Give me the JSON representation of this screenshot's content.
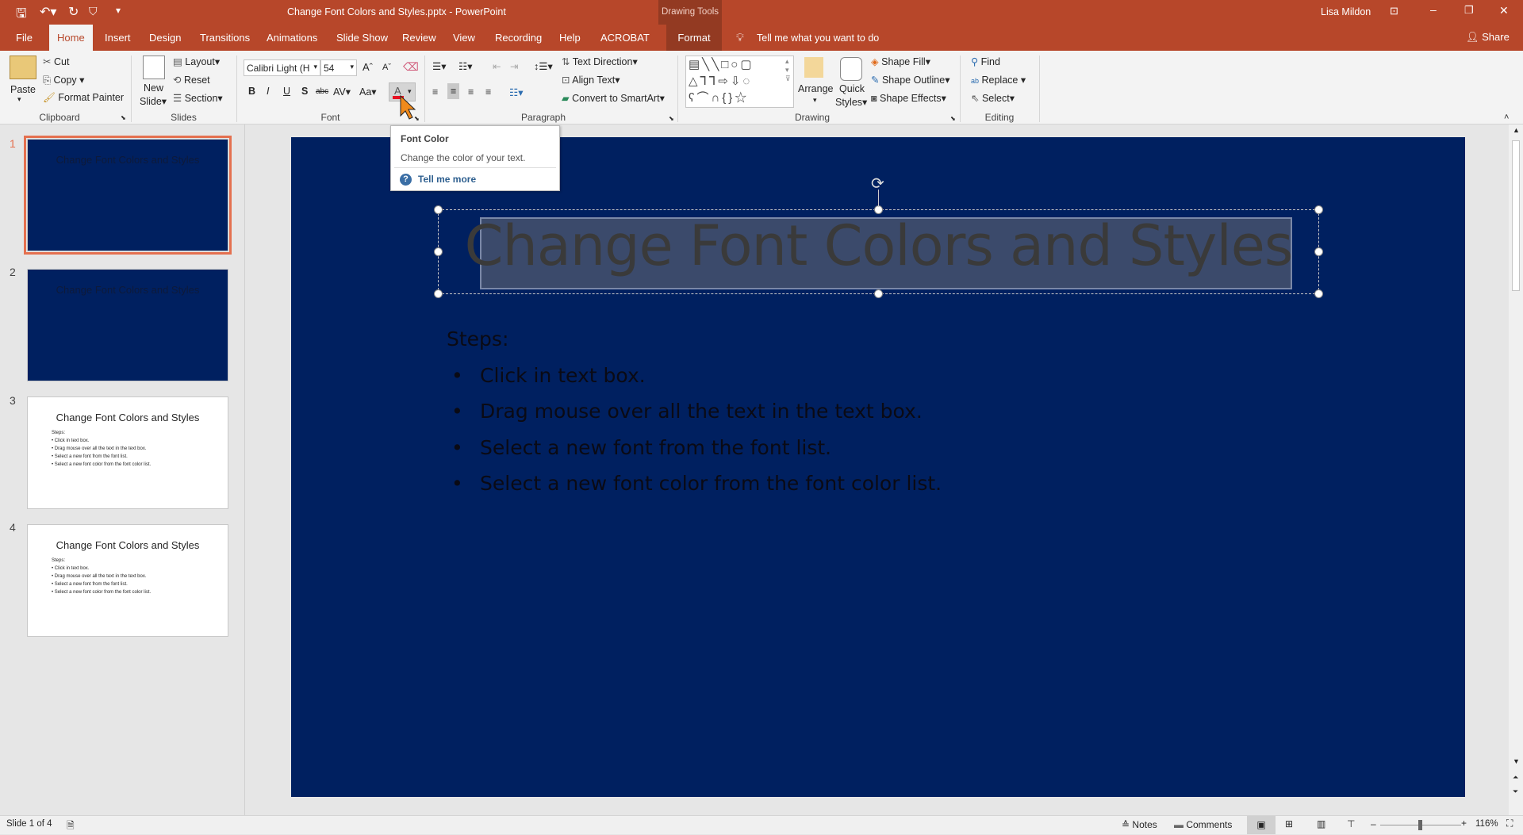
{
  "window": {
    "title": "Change Font Colors and Styles.pptx  -  PowerPoint",
    "contextual_group": "Drawing Tools",
    "user": "Lisa Mildon",
    "accent": "#b7472a"
  },
  "tabs": [
    {
      "label": "File"
    },
    {
      "label": "Home"
    },
    {
      "label": "Insert"
    },
    {
      "label": "Design"
    },
    {
      "label": "Transitions"
    },
    {
      "label": "Animations"
    },
    {
      "label": "Slide Show"
    },
    {
      "label": "Review"
    },
    {
      "label": "View"
    },
    {
      "label": "Recording"
    },
    {
      "label": "Help"
    },
    {
      "label": "ACROBAT"
    },
    {
      "label": "Format"
    }
  ],
  "tell_me": "Tell me what you want to do",
  "share": "Share",
  "ribbon": {
    "clipboard": {
      "label": "Clipboard",
      "paste": "Paste",
      "cut": "Cut",
      "copy": "Copy",
      "format_painter": "Format Painter"
    },
    "slides": {
      "label": "Slides",
      "new_slide": "New",
      "new_slide2": "Slide",
      "layout": "Layout",
      "reset": "Reset",
      "section": "Section"
    },
    "font": {
      "label": "Font",
      "font_name": "Calibri Light (H",
      "font_size": "54",
      "font_color": "#e81123"
    },
    "paragraph": {
      "label": "Paragraph",
      "text_direction": "Text Direction",
      "align_text": "Align Text",
      "smartart": "Convert to SmartArt"
    },
    "drawing": {
      "label": "Drawing",
      "arrange": "Arrange",
      "quick": "Quick",
      "styles": "Styles",
      "shape_fill": "Shape Fill",
      "shape_outline": "Shape Outline",
      "shape_effects": "Shape Effects"
    },
    "editing": {
      "label": "Editing",
      "find": "Find",
      "replace": "Replace",
      "select": "Select"
    }
  },
  "tooltip": {
    "title": "Font Color",
    "description": "Change the color of your text.",
    "link": "Tell me more"
  },
  "thumbnails": [
    {
      "num": "1",
      "title": "Change Font Colors and Styles",
      "theme": "dark"
    },
    {
      "num": "2",
      "title": "Change Font Colors and Styles",
      "theme": "dark"
    },
    {
      "num": "3",
      "title": "Change Font Colors and Styles",
      "theme": "light"
    },
    {
      "num": "4",
      "title": "Change Font Colors and Styles",
      "theme": "light"
    }
  ],
  "slide": {
    "title": "Change Font Colors and Styles",
    "steps_label": "Steps:",
    "bullets": [
      "Click in text box.",
      "Drag mouse over all the text in the text box.",
      "Select a new font from the font list.",
      "Select a new font color from the font color list."
    ],
    "background": "#002060"
  },
  "status": {
    "slide_of": "Slide 1 of 4",
    "notes": "Notes",
    "comments": "Comments",
    "zoom": "116%",
    "zoom_fraction": 0.5
  }
}
